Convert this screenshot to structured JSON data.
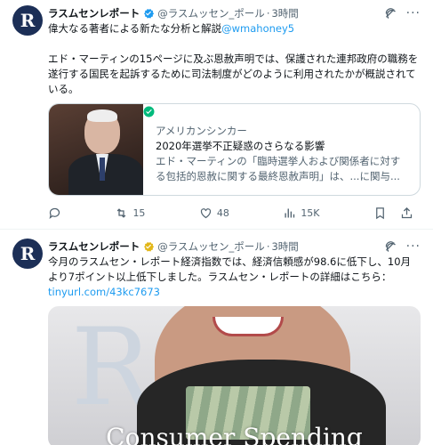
{
  "tweets": [
    {
      "author": "ラスムセンレポート",
      "avatar_letter": "R",
      "handle": "@ラスムッセン_ポール",
      "time": "3時間",
      "text_line1_prefix": "偉大なる著者による新たな分析と解説",
      "text_mention": "@wmahoney5",
      "text_para2": "エド・マーティンの15ページに及ぶ恩赦声明では、保護された連邦政府の職務を遂行する国民を起訴するために司法制度がどのように利用されたかが概説されている。",
      "card": {
        "domain": "アメリカンシンカー",
        "title": "2020年選挙不正疑惑のさらなる影響",
        "description": "エド・マーティンの「臨時選挙人および関係者に対する包括的恩赦に関する最終恩赦声明」は、...に関与..."
      },
      "retweets": "15",
      "likes": "48",
      "views": "15K"
    },
    {
      "author": "ラスムセンレポート",
      "avatar_letter": "R",
      "handle": "@ラスムッセン_ポール",
      "time": "3時間",
      "text": "今月のラスムセン・レポート経済指数では、経済信頼感が98.6に低下し、10月より7ポイント以上低下しました。ラスムセン・レポートの詳細はこちら：",
      "link": "tinyurl.com/43kc7673",
      "media_letter": "R",
      "media_caption": "Consumer Spending"
    }
  ],
  "colors": {
    "accent": "#1d9bf0",
    "muted": "#536471",
    "verified_gold": "#e2b719"
  },
  "icons": [
    "verified-badge-icon",
    "grok-icon",
    "more-icon",
    "reply-icon",
    "retweet-icon",
    "like-icon",
    "views-icon",
    "bookmark-icon",
    "share-icon"
  ]
}
